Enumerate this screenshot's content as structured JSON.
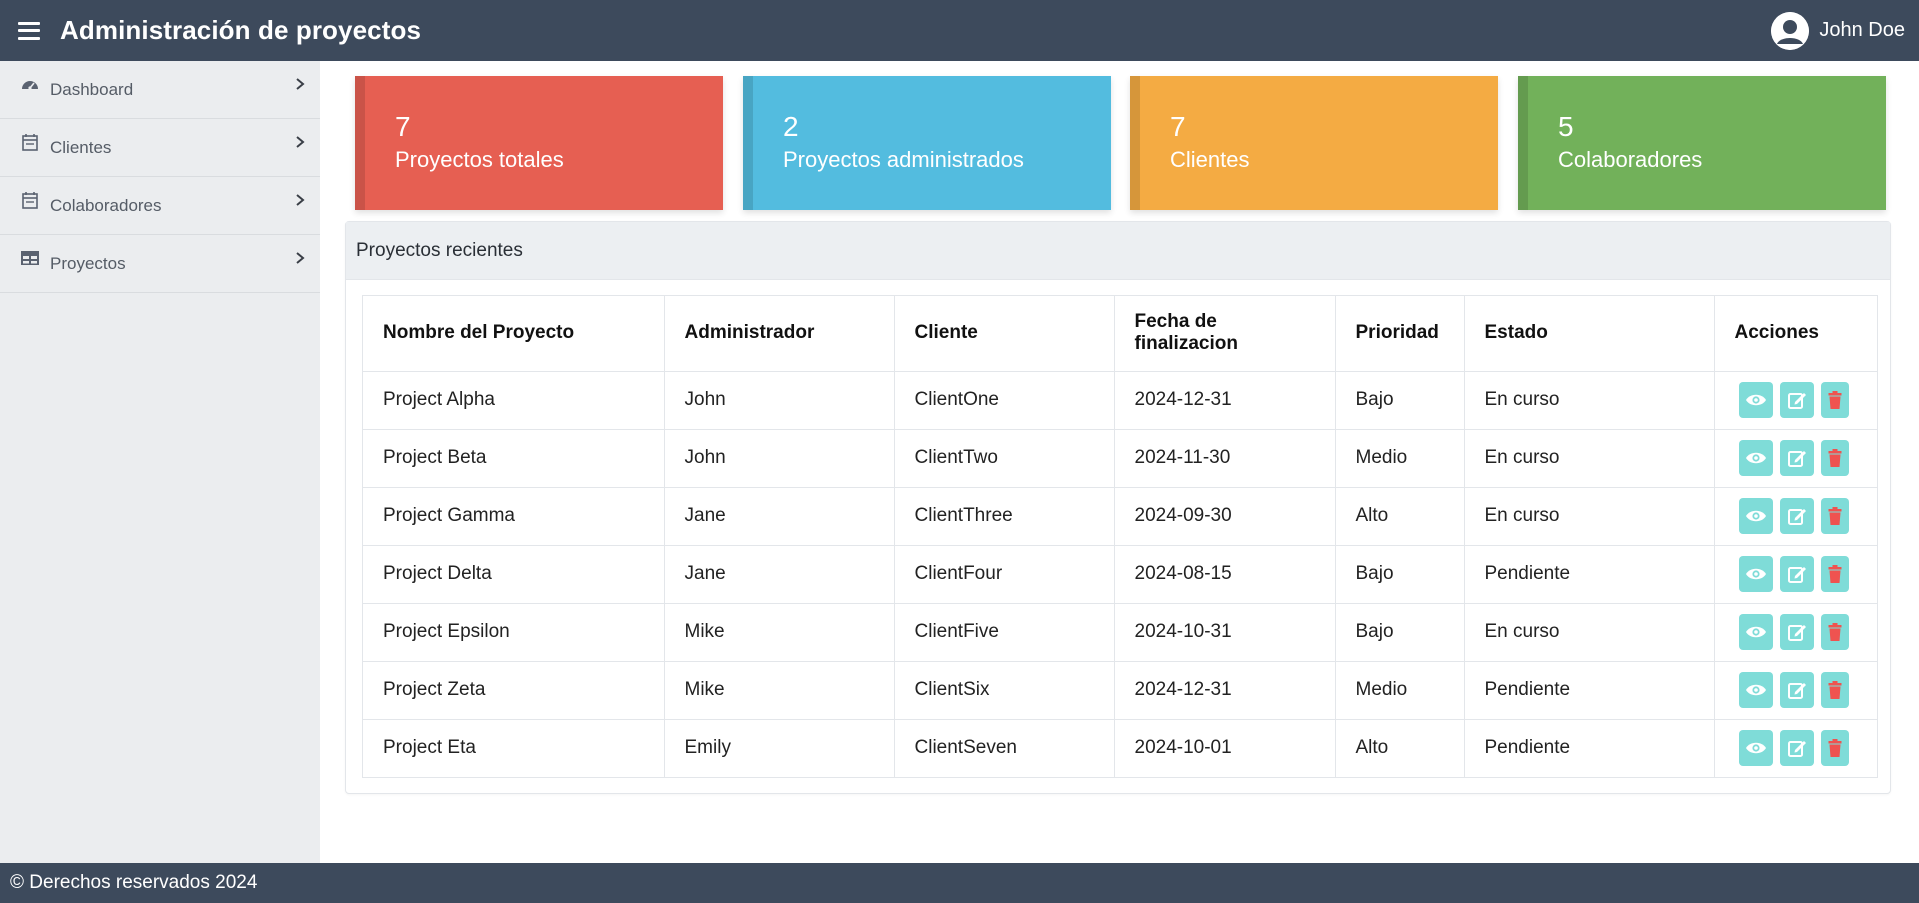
{
  "header": {
    "title": "Administración de proyectos",
    "user_name": "John Doe"
  },
  "sidebar": {
    "items": [
      {
        "label": "Dashboard",
        "icon": "gauge-icon"
      },
      {
        "label": "Clientes",
        "icon": "calendar-icon"
      },
      {
        "label": "Colaboradores",
        "icon": "calendar-icon"
      },
      {
        "label": "Proyectos",
        "icon": "table-icon"
      }
    ]
  },
  "stats": [
    {
      "value": "7",
      "label": "Proyectos totales",
      "color": "#e65f52"
    },
    {
      "value": "2",
      "label": "Proyectos administrados",
      "color": "#53bcdf"
    },
    {
      "value": "7",
      "label": "Clientes",
      "color": "#f4ab43"
    },
    {
      "value": "5",
      "label": "Colaboradores",
      "color": "#72b15a"
    }
  ],
  "recent": {
    "title": "Proyectos recientes",
    "columns": [
      "Nombre del Proyecto",
      "Administrador",
      "Cliente",
      "Fecha de finalizacion",
      "Prioridad",
      "Estado",
      "Acciones"
    ],
    "rows": [
      {
        "name": "Project Alpha",
        "admin": "John",
        "client": "ClientOne",
        "date": "2024-12-31",
        "priority": "Bajo",
        "status": "En curso"
      },
      {
        "name": "Project Beta",
        "admin": "John",
        "client": "ClientTwo",
        "date": "2024-11-30",
        "priority": "Medio",
        "status": "En curso"
      },
      {
        "name": "Project Gamma",
        "admin": "Jane",
        "client": "ClientThree",
        "date": "2024-09-30",
        "priority": "Alto",
        "status": "En curso"
      },
      {
        "name": "Project Delta",
        "admin": "Jane",
        "client": "ClientFour",
        "date": "2024-08-15",
        "priority": "Bajo",
        "status": "Pendiente"
      },
      {
        "name": "Project Epsilon",
        "admin": "Mike",
        "client": "ClientFive",
        "date": "2024-10-31",
        "priority": "Bajo",
        "status": "En curso"
      },
      {
        "name": "Project Zeta",
        "admin": "Mike",
        "client": "ClientSix",
        "date": "2024-12-31",
        "priority": "Medio",
        "status": "Pendiente"
      },
      {
        "name": "Project Eta",
        "admin": "Emily",
        "client": "ClientSeven",
        "date": "2024-10-01",
        "priority": "Alto",
        "status": "Pendiente"
      }
    ]
  },
  "footer": {
    "text": "© Derechos reservados 2024"
  },
  "colors": {
    "topbar": "#3d4a5c",
    "sidebar": "#ebedef",
    "action_button": "#7fdcd8",
    "delete_icon": "#ef5350"
  }
}
